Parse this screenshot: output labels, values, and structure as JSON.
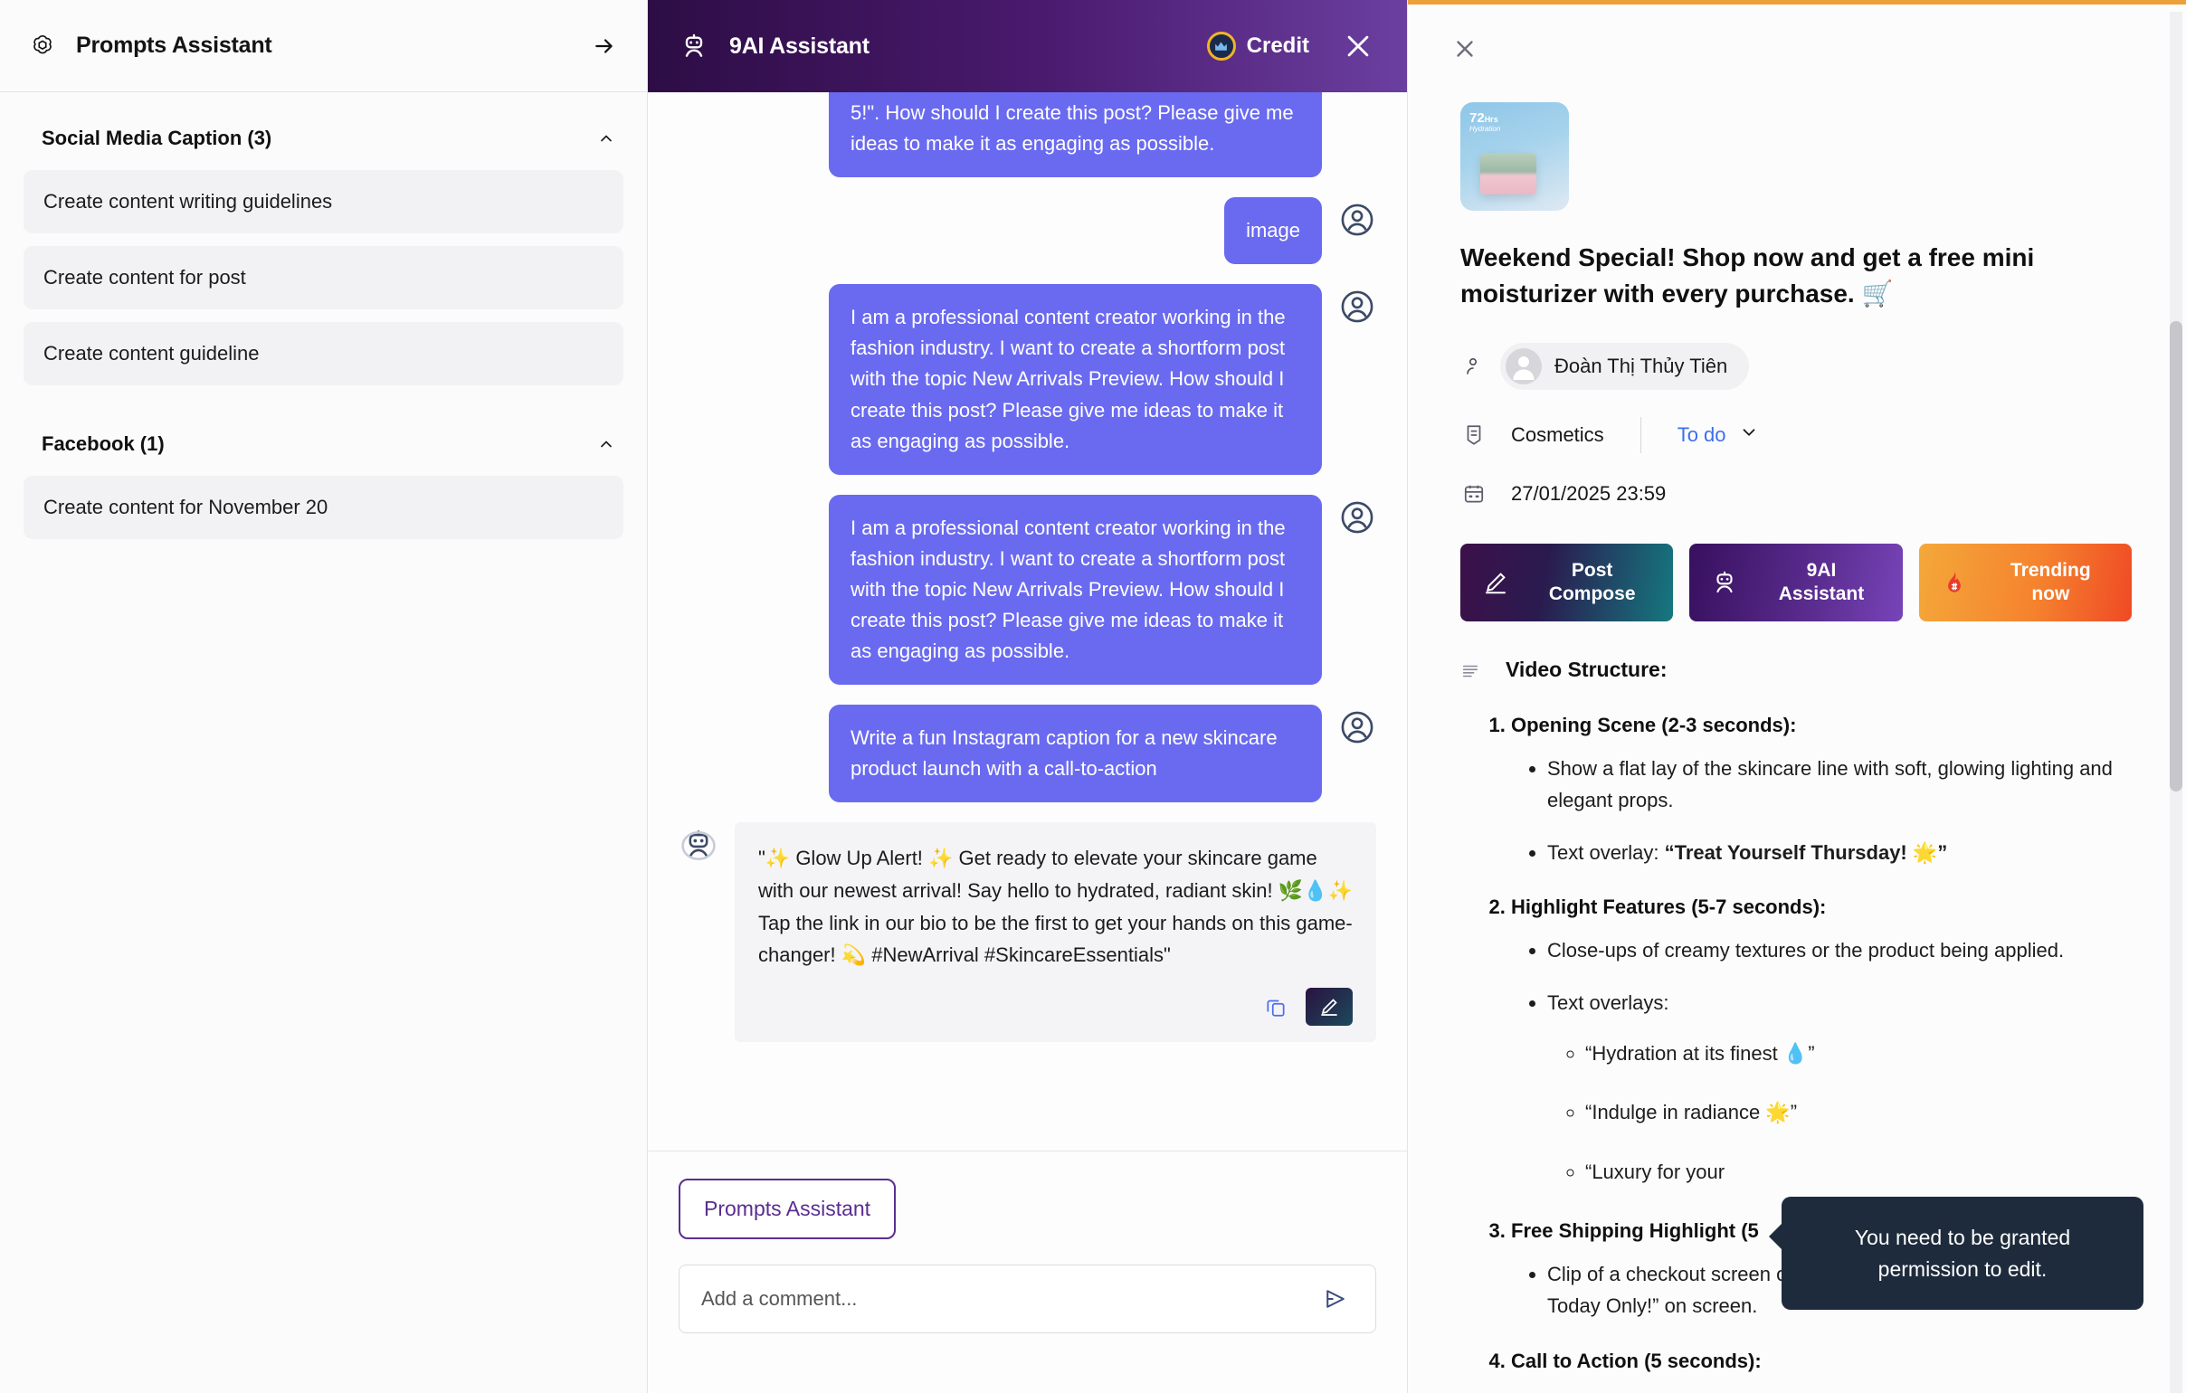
{
  "left_panel": {
    "logo_icon": "openai-flower-icon",
    "title": "Prompts Assistant",
    "collapse_icon": "arrow-right-icon",
    "groups": [
      {
        "title": "Social Media Caption (3)",
        "collapse_icon": "chevron-up-icon",
        "items": [
          "Create content writing guidelines",
          "Create content for post",
          "Create content guideline"
        ]
      },
      {
        "title": "Facebook (1)",
        "collapse_icon": "chevron-up-icon",
        "items": [
          "Create content for November 20"
        ]
      }
    ]
  },
  "chat_panel": {
    "header": {
      "bot_icon": "robot-icon",
      "title": "9AI Assistant",
      "credit_icon": "crown-coin-icon",
      "credit_label": "Credit",
      "close_icon": "close-icon"
    },
    "messages": [
      {
        "role": "user",
        "text": "5!\". How should I create this post? Please give me ideas to make it as engaging as possible.",
        "truncated": true
      },
      {
        "role": "user",
        "text": "image"
      },
      {
        "role": "user",
        "text": "I am a professional content creator working in the fashion industry. I want to create a shortform post with the topic New Arrivals Preview. How should I create this post? Please give me ideas to make it as engaging as possible."
      },
      {
        "role": "user",
        "text": "I am a professional content creator working in the fashion industry. I want to create a shortform post with the topic New Arrivals Preview. How should I create this post? Please give me ideas to make it as engaging as possible."
      },
      {
        "role": "user",
        "text": "Write a fun Instagram caption for a new skincare product launch with a call-to-action"
      },
      {
        "role": "assistant",
        "text": "\"✨ Glow Up Alert! ✨ Get ready to elevate your skincare game with our newest arrival! Say hello to hydrated, radiant skin! 🌿💧✨ Tap the link in our bio to be the first to get your hands on this game-changer! 💫 #NewArrival #SkincareEssentials\"",
        "copy_icon": "copy-icon",
        "edit_icon": "pencil-icon"
      }
    ],
    "footer": {
      "prompts_assistant_label": "Prompts Assistant",
      "comment_value": "",
      "comment_placeholder": "Add a comment...",
      "send_icon": "send-icon"
    }
  },
  "right_panel": {
    "close_icon": "close-icon",
    "thumbnail": {
      "badge_number": "72",
      "badge_unit": "Hrs",
      "badge_sub": "Hydration",
      "alt": "moisturizer-jar-thumbnail"
    },
    "post_title": "Weekend Special! Shop now and get a free mini moisturizer with every purchase. 🛒",
    "author": {
      "person_icon": "person-icon",
      "avatar_icon": "avatar-icon",
      "name": "Đoàn Thị Thủy Tiên"
    },
    "meta": {
      "category_icon": "brand-tag-icon",
      "category": "Cosmetics",
      "status": "To do",
      "status_chevron_icon": "chevron-down-icon",
      "date_icon": "calendar-icon",
      "date": "27/01/2025 23:59"
    },
    "actions": [
      {
        "icon": "pencil-icon",
        "label_line1": "Post",
        "label_line2": "Compose"
      },
      {
        "icon": "robot-icon",
        "label_line1": "9AI",
        "label_line2": "Assistant"
      },
      {
        "icon": "fire-hash-icon",
        "label_line1": "Trending",
        "label_line2": "now"
      }
    ],
    "content": {
      "lines_icon": "list-lines-icon",
      "heading": "Video Structure:",
      "steps": [
        {
          "title": "Opening Scene (2-3 seconds):",
          "bullets": [
            {
              "text": "Show a flat lay of the skincare line with soft, glowing lighting and elegant props."
            },
            {
              "text": "Text overlay: ",
              "bold_tail": "“Treat Yourself Thursday! 🌟”"
            }
          ]
        },
        {
          "title": "Highlight Features (5-7 seconds):",
          "bullets": [
            {
              "text": "Close-ups of creamy textures or the product being applied."
            },
            {
              "text": "Text overlays:",
              "subbullets": [
                "“Hydration at its finest 💧”",
                "“Indulge in radiance 🌟”",
                "“Luxury for your"
              ]
            }
          ]
        },
        {
          "title": "Free Shipping Highlight (5",
          "bullets": [
            {
              "text": "Clip of a checkout screen or shipping box with “FREE SHIPPING Today Only!” on screen."
            }
          ]
        },
        {
          "title": "Call to Action (5 seconds):",
          "bullets": []
        }
      ]
    },
    "tooltip": "You need to be granted permission to edit."
  },
  "colors": {
    "accent_purple": "#5b2d90",
    "bubble_user": "#6a6af0",
    "status_blue": "#3b6ef0",
    "orange_bar": "#eda037",
    "tooltip_bg": "#1e2b3c"
  }
}
